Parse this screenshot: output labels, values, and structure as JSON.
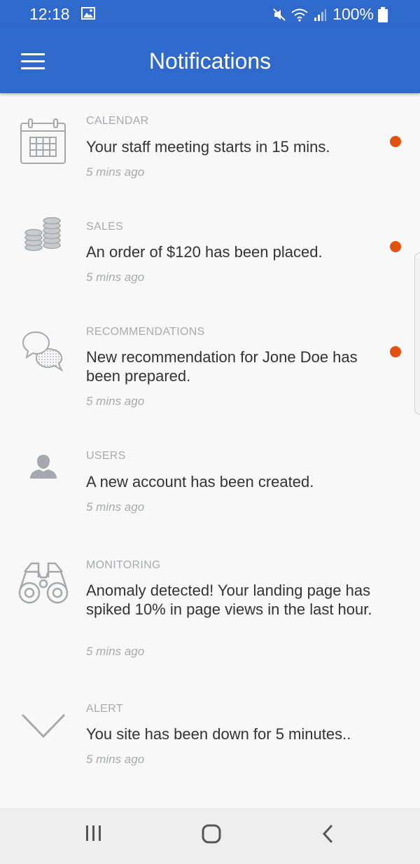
{
  "status_bar": {
    "time": "12:18",
    "battery": "100%"
  },
  "header": {
    "title": "Notifications"
  },
  "notifications": [
    {
      "category": "CALENDAR",
      "message": "Your staff meeting starts in 15 mins.",
      "time": "5 mins ago",
      "icon": "calendar-icon",
      "unread": true
    },
    {
      "category": "SALES",
      "message": "An order of $120 has been placed.",
      "time": "5 mins ago",
      "icon": "coins-icon",
      "unread": true
    },
    {
      "category": "RECOMMENDATIONS",
      "message": "New recommendation for Jone Doe has been prepared.",
      "time": "5 mins ago",
      "icon": "chat-bubbles-icon",
      "unread": true
    },
    {
      "category": "USERS",
      "message": "A new account has been created.",
      "time": "5 mins ago",
      "icon": "user-icon",
      "unread": false
    },
    {
      "category": "MONITORING",
      "message": "Anomaly detected! Your landing page has spiked 10% in page views in the last hour.",
      "time": "5 mins ago",
      "icon": "binoculars-icon",
      "unread": false
    },
    {
      "category": "ALERT",
      "message": "You site has been down for 5 minutes..",
      "time": "5 mins ago",
      "icon": "chevron-down-icon",
      "unread": false
    }
  ],
  "colors": {
    "primary": "#3069cc",
    "unread_dot": "#e2520e",
    "muted_text": "#a9aaae",
    "body_text": "#333333",
    "icon_gray": "#a6a8ae"
  }
}
